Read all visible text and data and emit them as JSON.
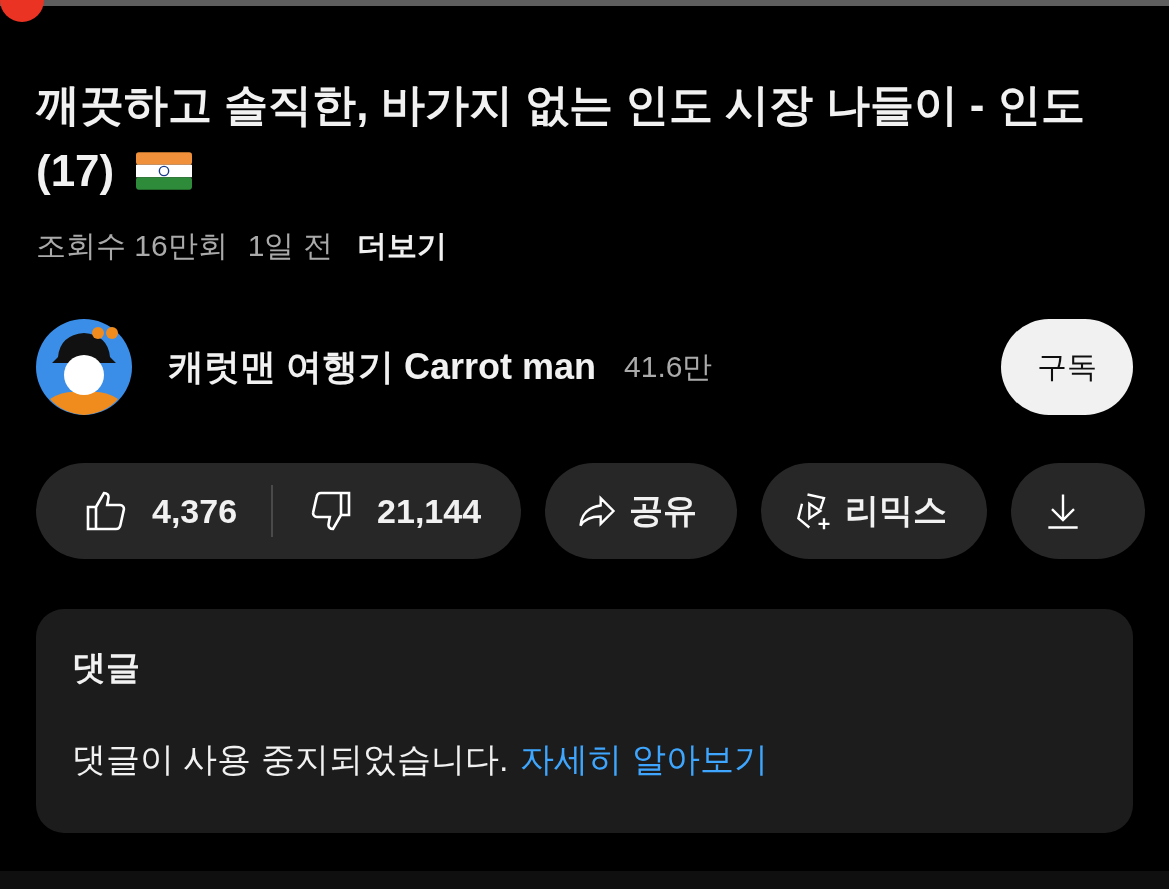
{
  "player": {
    "progress": {
      "level": 0.015
    }
  },
  "video": {
    "title": "깨끗하고 솔직한, 바가지 없는 인도 시장 나들이 - 인도(17)",
    "views": "조회수 16만회",
    "age": "1일 전",
    "more": "더보기"
  },
  "channel": {
    "name": "캐럿맨 여행기 Carrot man",
    "subscribers": "41.6만",
    "subscribe": "구독"
  },
  "actions": {
    "likes": "4,376",
    "dislikes": "21,144",
    "buttons": [
      {
        "kind": "share",
        "label": "공유"
      },
      {
        "kind": "remix",
        "label": "리믹스"
      },
      {
        "kind": "download"
      }
    ]
  },
  "comments": {
    "heading": "댓글",
    "message": "댓글이 사용 중지되었습니다.",
    "link": "자세히 알아보기"
  }
}
